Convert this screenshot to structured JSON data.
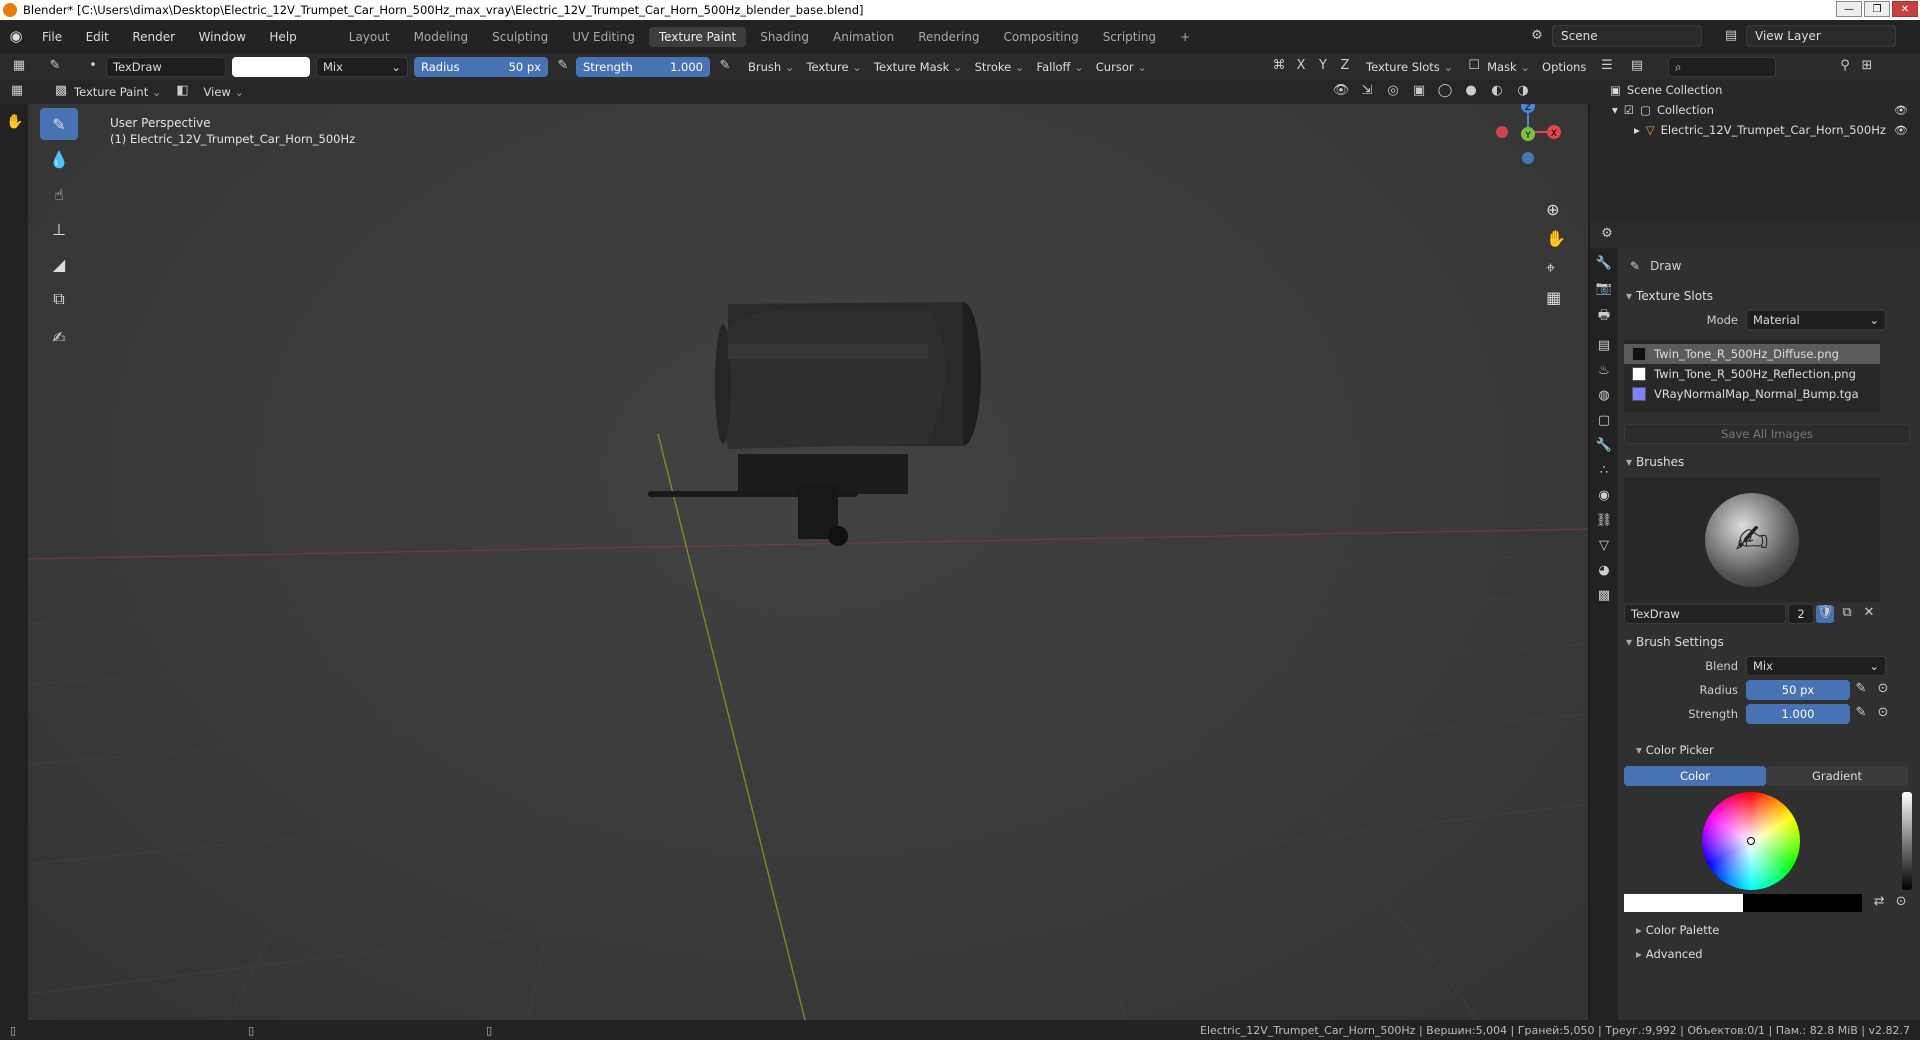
{
  "window": {
    "title": "Blender* [C:\\Users\\dimax\\Desktop\\Electric_12V_Trumpet_Car_Horn_500Hz_max_vray\\Electric_12V_Trumpet_Car_Horn_500Hz_blender_base.blend]",
    "buttons": [
      "—",
      "❐",
      "✕"
    ]
  },
  "menu": [
    "File",
    "Edit",
    "Render",
    "Window",
    "Help"
  ],
  "workspaces": [
    "Layout",
    "Modeling",
    "Sculpting",
    "UV Editing",
    "Texture Paint",
    "Shading",
    "Animation",
    "Rendering",
    "Compositing",
    "Scripting",
    "+"
  ],
  "active_workspace": "Texture Paint",
  "scene": {
    "label": "Scene",
    "view_layer": "View Layer"
  },
  "tool_header": {
    "brush_name": "TexDraw",
    "blend": "Mix",
    "radius_label": "Radius",
    "radius_value": "50 px",
    "strength_label": "Strength",
    "strength_value": "1.000",
    "dropdowns": [
      "Brush",
      "Texture",
      "Texture Mask",
      "Stroke",
      "Falloff",
      "Cursor"
    ],
    "axes": [
      "X",
      "Y",
      "Z"
    ],
    "right_dropdowns": [
      "Texture Slots",
      "Mask",
      "Options"
    ]
  },
  "mode_header": {
    "mode": "Texture Paint",
    "view": "View"
  },
  "viewport": {
    "perspective": "User Perspective",
    "object_label": "(1) Electric_12V_Trumpet_Car_Horn_500Hz",
    "gizmo": {
      "x": "X",
      "y": "Y",
      "z": "Z"
    }
  },
  "outliner": {
    "scene_collection": "Scene Collection",
    "collection": "Collection",
    "object": "Electric_12V_Trumpet_Car_Horn_500Hz"
  },
  "properties": {
    "tool_name": "Draw",
    "texture_slots": {
      "title": "Texture Slots",
      "mode_label": "Mode",
      "mode_value": "Material",
      "slots": [
        {
          "name": "Twin_Tone_R_500Hz_Diffuse.png",
          "color": "#111111",
          "selected": true
        },
        {
          "name": "Twin_Tone_R_500Hz_Reflection.png",
          "color": "#ffffff",
          "selected": false
        },
        {
          "name": "VRayNormalMap_Normal_Bump.tga",
          "color": "#8080ff",
          "selected": false
        }
      ],
      "save_all": "Save All Images"
    },
    "brushes": {
      "title": "Brushes",
      "name": "TexDraw",
      "users": "2"
    },
    "brush_settings": {
      "title": "Brush Settings",
      "blend_label": "Blend",
      "blend_value": "Mix",
      "radius_label": "Radius",
      "radius_value": "50 px",
      "strength_label": "Strength",
      "strength_value": "1.000"
    },
    "color_picker": {
      "title": "Color Picker",
      "tab_color": "Color",
      "tab_gradient": "Gradient"
    },
    "color_palette": "Color Palette",
    "advanced": "Advanced"
  },
  "status": {
    "text": "Electric_12V_Trumpet_Car_Horn_500Hz | Вершин:5,004 | Граней:5,050 | Треуг.:9,992 | Объектов:0/1 | Пам.: 82.8 MiB | v2.82.7"
  },
  "colors": {
    "accent": "#4772b3",
    "x_axis": "#e0464a",
    "y_axis": "#7fbf3f",
    "z_axis": "#4a86d4"
  }
}
